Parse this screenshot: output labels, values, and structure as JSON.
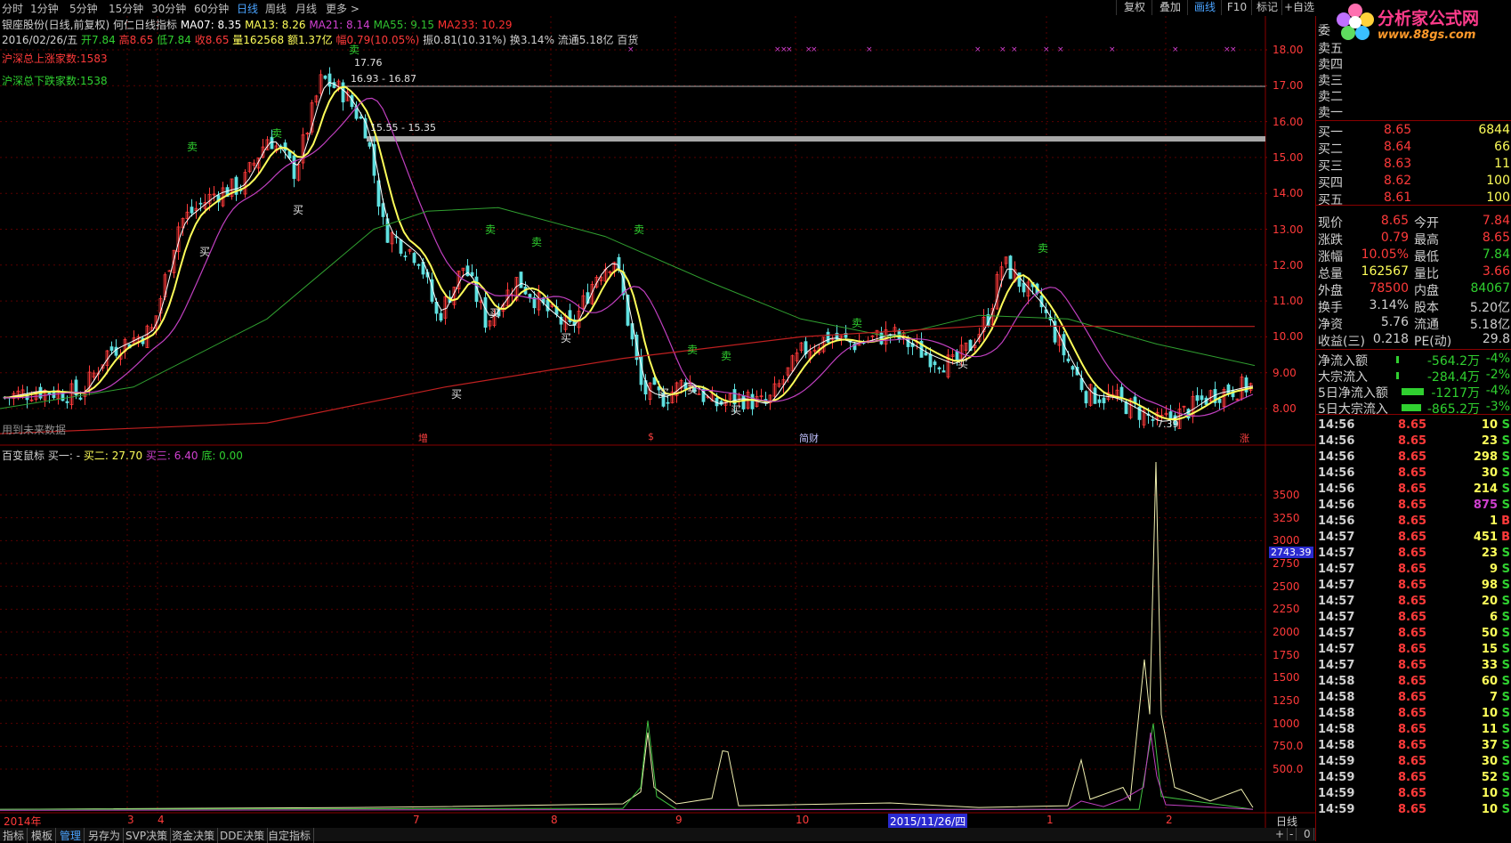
{
  "toolbar": {
    "periods": [
      "分时",
      "1分钟",
      "5分钟",
      "15分钟",
      "30分钟",
      "60分钟",
      "日线",
      "周线",
      "月线",
      "更多 >"
    ],
    "active_period": "日线",
    "right_buttons": [
      "复权",
      "叠加",
      "画线",
      "F10",
      "标记",
      "+自选"
    ]
  },
  "logo": {
    "name": "分析家公式网",
    "url": "www.88gs.com"
  },
  "header": {
    "line1_prefix": "银座股份(日线,前复权) 何仁日线指标",
    "ma07": "MA07: 8.35",
    "ma13": "MA13: 8.26",
    "ma21": "MA21: 8.14",
    "ma55": "MA55: 9.15",
    "ma233": "MA233: 10.29",
    "date": "2016/02/26/五",
    "open": "开7.84",
    "high": "高8.65",
    "low": "低7.84",
    "close": "收8.65",
    "volume": "量162568",
    "amount": "额1.37亿",
    "change": "幅0.79(10.05%)",
    "amplitude": "振0.81(10.31%)",
    "turnover": "换3.14%",
    "float": "流通5.18亿",
    "sector": "百货"
  },
  "main_chart": {
    "up_count": "沪深总上涨家数:1583",
    "down_count": "沪深总下跌家数:1538",
    "high_label": "17.76",
    "range1": "16.93 - 16.87",
    "range2": "15.55 - 15.35",
    "low_label": "7.39",
    "future_note": "用到未来数据",
    "events": [
      "增",
      "$",
      "简财",
      "涨"
    ],
    "y_ticks": [
      "18.00",
      "17.00",
      "16.00",
      "15.00",
      "14.00",
      "13.00",
      "12.00",
      "11.00",
      "10.00",
      "9.00",
      "8.00"
    ],
    "buy_label": "买",
    "sell_label": "卖"
  },
  "sub_chart": {
    "title": "百变鼠标",
    "buy1": "买一: -",
    "buy2": "买二: 27.70",
    "buy3": "买三: 6.40",
    "bottom": "底: 0.00",
    "y_ticks": [
      "3500",
      "3250",
      "3000",
      "2750",
      "2500",
      "2250",
      "2000",
      "1750",
      "1500",
      "1250",
      "1000",
      "750.0",
      "500.0"
    ],
    "cursor_value": "2743.39"
  },
  "x_axis": {
    "labels": [
      "2014年",
      "3",
      "4",
      "7",
      "8",
      "9",
      "10",
      "1",
      "2"
    ],
    "highlight": "2015/11/26/四",
    "period": "日线"
  },
  "order_book": {
    "sells": [
      {
        "label": "委"
      },
      {
        "label": "卖五"
      },
      {
        "label": "卖四"
      },
      {
        "label": "卖三"
      },
      {
        "label": "卖二"
      },
      {
        "label": "卖一"
      }
    ],
    "buys": [
      {
        "label": "买一",
        "price": "8.65",
        "vol": "6844"
      },
      {
        "label": "买二",
        "price": "8.64",
        "vol": "66"
      },
      {
        "label": "买三",
        "price": "8.63",
        "vol": "11"
      },
      {
        "label": "买四",
        "price": "8.62",
        "vol": "100"
      },
      {
        "label": "买五",
        "price": "8.61",
        "vol": "100"
      }
    ]
  },
  "quote": [
    {
      "l1": "现价",
      "v1": "8.65",
      "l2": "今开",
      "v2": "7.84"
    },
    {
      "l1": "涨跌",
      "v1": "0.79",
      "l2": "最高",
      "v2": "8.65"
    },
    {
      "l1": "涨幅",
      "v1": "10.05%",
      "l2": "最低",
      "v2": "7.84"
    },
    {
      "l1": "总量",
      "v1": "162567",
      "l2": "量比",
      "v2": "3.66"
    },
    {
      "l1": "外盘",
      "v1": "78500",
      "l2": "内盘",
      "v2": "84067"
    },
    {
      "l1": "换手",
      "v1": "3.14%",
      "l2": "股本",
      "v2": "5.20亿"
    },
    {
      "l1": "净资",
      "v1": "5.76",
      "l2": "流通",
      "v2": "5.18亿"
    },
    {
      "l1": "收益(三)",
      "v1": "0.218",
      "l2": "PE(动)",
      "v2": "29.8"
    }
  ],
  "flows": [
    {
      "label": "净流入额",
      "value": "-564.2万",
      "pct": "-4%",
      "bar": 0.1
    },
    {
      "label": "大宗流入",
      "value": "-284.4万",
      "pct": "-2%",
      "bar": 0.03
    },
    {
      "label": "5日净流入额",
      "value": "-1217万",
      "pct": "-4%",
      "bar": 0.95
    },
    {
      "label": "5日大宗流入",
      "value": "-865.2万",
      "pct": "-3%",
      "bar": 0.85
    }
  ],
  "ticks": [
    {
      "t": "14:56",
      "p": "8.65",
      "v": "10",
      "s": "S"
    },
    {
      "t": "14:56",
      "p": "8.65",
      "v": "23",
      "s": "S"
    },
    {
      "t": "14:56",
      "p": "8.65",
      "v": "298",
      "s": "S"
    },
    {
      "t": "14:56",
      "p": "8.65",
      "v": "30",
      "s": "S"
    },
    {
      "t": "14:56",
      "p": "8.65",
      "v": "214",
      "s": "S"
    },
    {
      "t": "14:56",
      "p": "8.65",
      "v": "875",
      "s": "S"
    },
    {
      "t": "14:56",
      "p": "8.65",
      "v": "1",
      "s": "B"
    },
    {
      "t": "14:57",
      "p": "8.65",
      "v": "451",
      "s": "B"
    },
    {
      "t": "14:57",
      "p": "8.65",
      "v": "23",
      "s": "S"
    },
    {
      "t": "14:57",
      "p": "8.65",
      "v": "9",
      "s": "S"
    },
    {
      "t": "14:57",
      "p": "8.65",
      "v": "98",
      "s": "S"
    },
    {
      "t": "14:57",
      "p": "8.65",
      "v": "20",
      "s": "S"
    },
    {
      "t": "14:57",
      "p": "8.65",
      "v": "6",
      "s": "S"
    },
    {
      "t": "14:57",
      "p": "8.65",
      "v": "50",
      "s": "S"
    },
    {
      "t": "14:57",
      "p": "8.65",
      "v": "15",
      "s": "S"
    },
    {
      "t": "14:57",
      "p": "8.65",
      "v": "33",
      "s": "S"
    },
    {
      "t": "14:58",
      "p": "8.65",
      "v": "60",
      "s": "S"
    },
    {
      "t": "14:58",
      "p": "8.65",
      "v": "7",
      "s": "S"
    },
    {
      "t": "14:58",
      "p": "8.65",
      "v": "10",
      "s": "S"
    },
    {
      "t": "14:58",
      "p": "8.65",
      "v": "11",
      "s": "S"
    },
    {
      "t": "14:58",
      "p": "8.65",
      "v": "37",
      "s": "S"
    },
    {
      "t": "14:59",
      "p": "8.65",
      "v": "30",
      "s": "S"
    },
    {
      "t": "14:59",
      "p": "8.65",
      "v": "52",
      "s": "S"
    },
    {
      "t": "14:59",
      "p": "8.65",
      "v": "10",
      "s": "S"
    },
    {
      "t": "14:59",
      "p": "8.65",
      "v": "10",
      "s": "S"
    }
  ],
  "bottom_tabs": [
    "指标",
    "模板",
    "管理",
    "另存为",
    "SVP决策",
    "资金决策",
    "DDE决策",
    "自定指标"
  ],
  "active_tab": "管理",
  "bottom_right": [
    "+",
    "-",
    "0"
  ],
  "colors": {
    "up": "#ff3a3a",
    "down": "#5fe0e0",
    "yellow": "#ffff5a",
    "purple": "#c040c0",
    "green": "#30a030",
    "red": "#c02020"
  }
}
